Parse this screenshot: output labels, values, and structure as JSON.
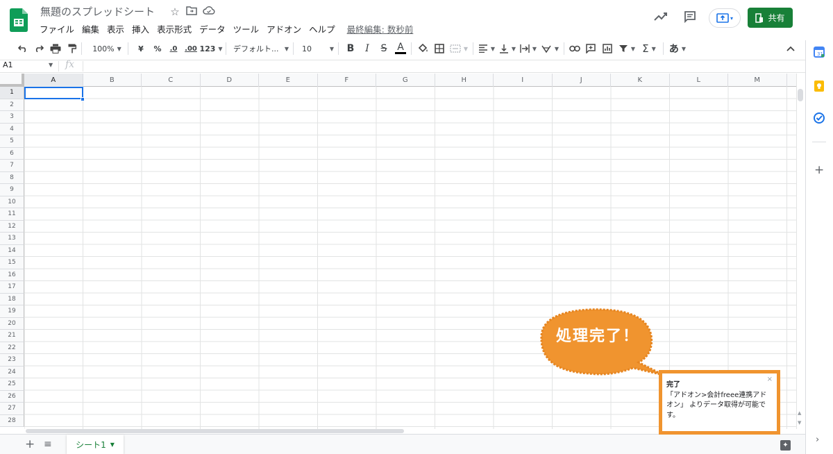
{
  "header": {
    "doc_title": "無題のスプレッドシート",
    "menu": [
      "ファイル",
      "編集",
      "表示",
      "挿入",
      "表示形式",
      "データ",
      "ツール",
      "アドオン",
      "ヘルプ"
    ],
    "last_edit": "最終編集: 数秒前",
    "share_label": "共有"
  },
  "toolbar": {
    "zoom": "100%",
    "currency": "¥",
    "percent": "%",
    "decrease_decimal": ".0",
    "increase_decimal": ".00",
    "more_formats": "123",
    "font": "デフォルト...",
    "font_size": "10",
    "bold": "B",
    "italic": "I",
    "strike": "S",
    "text_color": "A",
    "input_tools": "あ"
  },
  "formula_bar": {
    "name_box": "A1",
    "fx": "fx"
  },
  "grid": {
    "columns": [
      "A",
      "B",
      "C",
      "D",
      "E",
      "F",
      "G",
      "H",
      "I",
      "J",
      "K",
      "L",
      "M"
    ],
    "rows": [
      "1",
      "2",
      "3",
      "4",
      "5",
      "6",
      "7",
      "8",
      "9",
      "10",
      "11",
      "12",
      "13",
      "14",
      "15",
      "16",
      "17",
      "18",
      "19",
      "20",
      "21",
      "22",
      "23",
      "24",
      "25",
      "26",
      "27",
      "28"
    ],
    "selected_cell": "A1"
  },
  "sheets": {
    "active_tab": "シート1"
  },
  "toast": {
    "title": "完了",
    "message": "「アドオン>会計freee連携アドオン」 よりデータ取得が可能です。"
  },
  "callout": {
    "text": "処理完了！"
  },
  "colors": {
    "share_green": "#188038",
    "selection_blue": "#1a73e8",
    "callout_orange": "#f0942f"
  }
}
